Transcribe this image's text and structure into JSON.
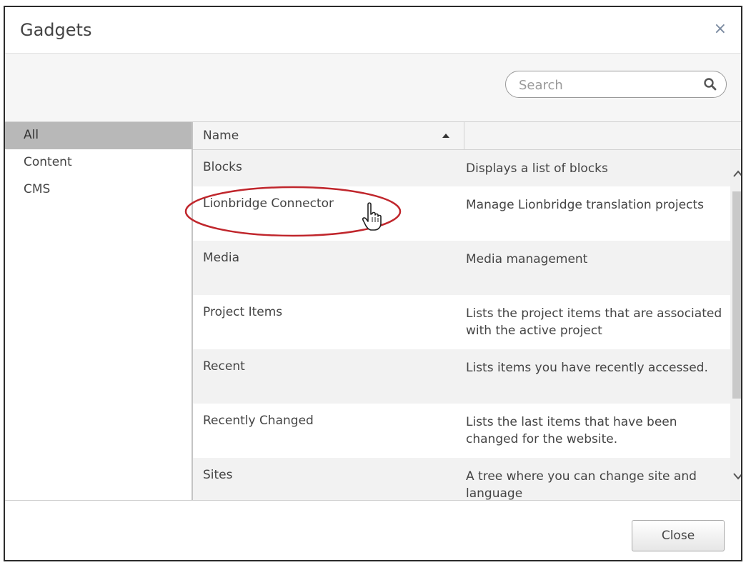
{
  "dialog": {
    "title": "Gadgets",
    "close_glyph": "×"
  },
  "search": {
    "placeholder": "Search",
    "icon": "search-icon"
  },
  "sidebar": {
    "items": [
      {
        "label": "All",
        "selected": true
      },
      {
        "label": "Content",
        "selected": false
      },
      {
        "label": "CMS",
        "selected": false
      }
    ]
  },
  "grid": {
    "columns": {
      "name": "Name",
      "sort": "ascending"
    },
    "rows": [
      {
        "name": "Blocks",
        "description": "Displays a list of blocks"
      },
      {
        "name": "Lionbridge Connector",
        "description": "Manage Lionbridge translation projects"
      },
      {
        "name": "Media",
        "description": "Media management"
      },
      {
        "name": "Project Items",
        "description": "Lists the project items that are associated with the active project"
      },
      {
        "name": "Recent",
        "description": "Lists items you have recently accessed."
      },
      {
        "name": "Recently Changed",
        "description": "Lists the last items that have been changed for the website."
      },
      {
        "name": "Sites",
        "description": "A tree where you can change site and language"
      }
    ]
  },
  "footer": {
    "close_label": "Close"
  },
  "annotation": {
    "highlight_color": "#c0262c",
    "highlighted_row": "Lionbridge Connector"
  }
}
